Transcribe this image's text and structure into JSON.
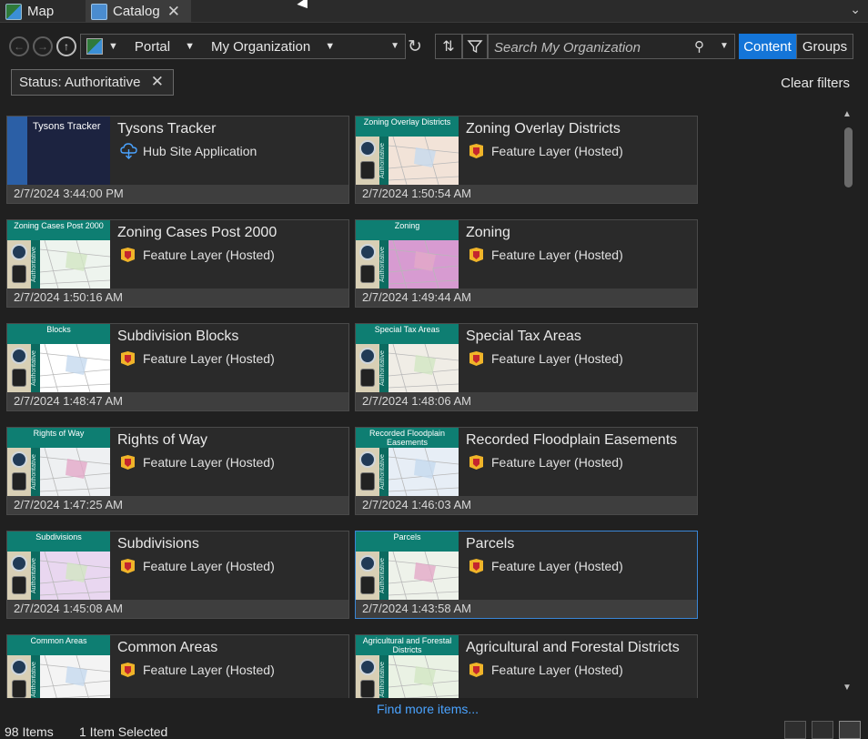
{
  "tabs": [
    {
      "label": "Map",
      "icon": "map-icon",
      "active": false
    },
    {
      "label": "Catalog",
      "icon": "catalog-icon",
      "active": true
    }
  ],
  "toolbar": {
    "location_portal": "Portal",
    "location_org": "My Organization",
    "search_placeholder": "Search My Organization",
    "content_label": "Content",
    "groups_label": "Groups"
  },
  "filter": {
    "chip_label": "Status: Authoritative",
    "clear_label": "Clear filters"
  },
  "items": [
    {
      "title": "Tysons Tracker",
      "type": "Hub Site Application",
      "date": "2/7/2024 3:44:00 PM",
      "thumb_label": "Tysons Tracker",
      "selected": false
    },
    {
      "title": "Zoning Overlay Districts",
      "type": "Feature Layer (Hosted)",
      "date": "2/7/2024 1:50:54 AM",
      "thumb_label": "Zoning Overlay Districts",
      "selected": false
    },
    {
      "title": "Zoning Cases Post 2000",
      "type": "Feature Layer (Hosted)",
      "date": "2/7/2024 1:50:16 AM",
      "thumb_label": "Zoning Cases Post 2000",
      "selected": false
    },
    {
      "title": "Zoning",
      "type": "Feature Layer (Hosted)",
      "date": "2/7/2024 1:49:44 AM",
      "thumb_label": "Zoning",
      "selected": false
    },
    {
      "title": "Subdivision Blocks",
      "type": "Feature Layer (Hosted)",
      "date": "2/7/2024 1:48:47 AM",
      "thumb_label": "Blocks",
      "selected": false
    },
    {
      "title": "Special Tax Areas",
      "type": "Feature Layer (Hosted)",
      "date": "2/7/2024 1:48:06 AM",
      "thumb_label": "Special Tax Areas",
      "selected": false
    },
    {
      "title": "Rights of Way",
      "type": "Feature Layer (Hosted)",
      "date": "2/7/2024 1:47:25 AM",
      "thumb_label": "Rights of Way",
      "selected": false
    },
    {
      "title": "Recorded Floodplain Easements",
      "type": "Feature Layer (Hosted)",
      "date": "2/7/2024 1:46:03 AM",
      "thumb_label": "Recorded Floodplain Easements",
      "selected": false
    },
    {
      "title": "Subdivisions",
      "type": "Feature Layer (Hosted)",
      "date": "2/7/2024 1:45:08 AM",
      "thumb_label": "Subdivisions",
      "selected": false
    },
    {
      "title": "Parcels",
      "type": "Feature Layer (Hosted)",
      "date": "2/7/2024 1:43:58 AM",
      "thumb_label": "Parcels",
      "selected": true
    },
    {
      "title": "Common Areas",
      "type": "Feature Layer (Hosted)",
      "date": "",
      "thumb_label": "Common Areas",
      "selected": false
    },
    {
      "title": "Agricultural and Forestal Districts",
      "type": "Feature Layer (Hosted)",
      "date": "",
      "thumb_label": "Agricultural and Forestal Districts",
      "selected": false
    }
  ],
  "thumb_strip_text": "Authoritative",
  "find_more": "Find more items...",
  "status": {
    "count": "98 Items",
    "selected": "1 Item Selected"
  },
  "colors": {
    "accent": "#1475d8",
    "thumb_band": "#0e7e72",
    "link": "#4aa3ff"
  }
}
